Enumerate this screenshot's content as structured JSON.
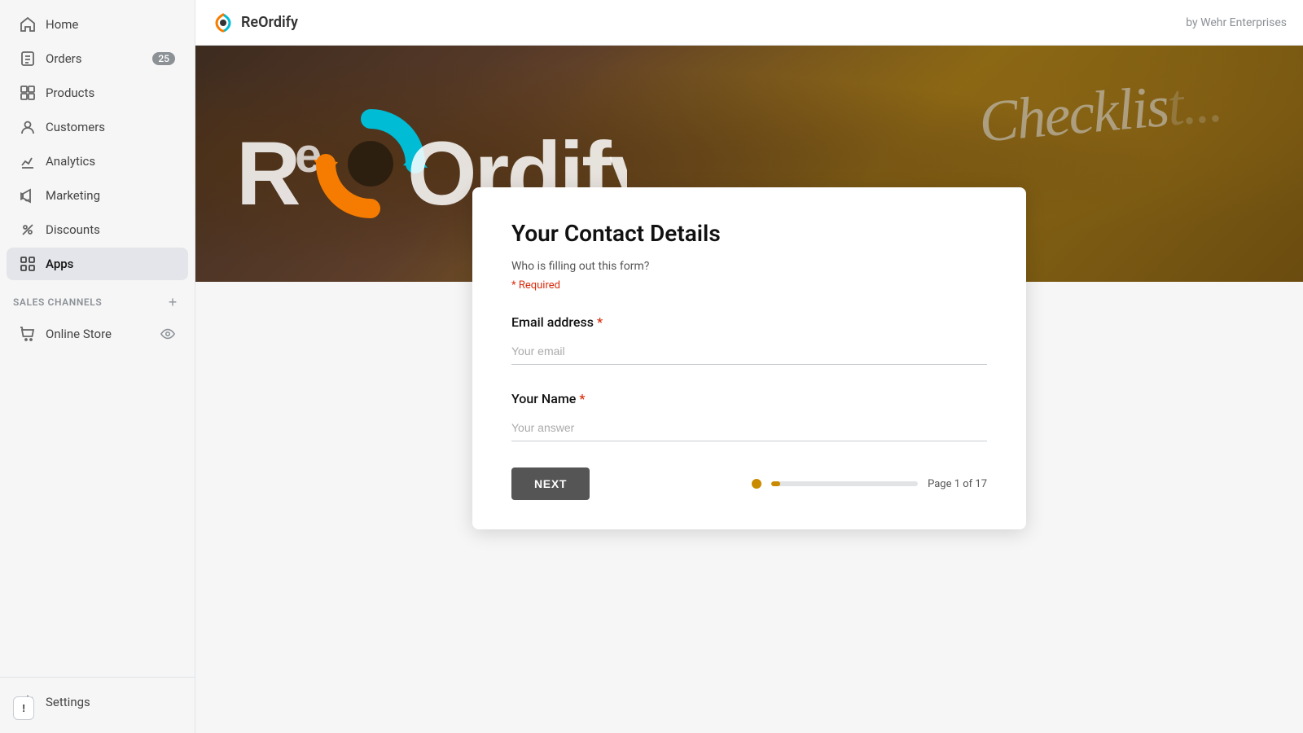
{
  "sidebar": {
    "items": [
      {
        "id": "home",
        "label": "Home",
        "icon": "home-icon",
        "badge": null,
        "active": false
      },
      {
        "id": "orders",
        "label": "Orders",
        "icon": "orders-icon",
        "badge": "25",
        "active": false
      },
      {
        "id": "products",
        "label": "Products",
        "icon": "products-icon",
        "badge": null,
        "active": false
      },
      {
        "id": "customers",
        "label": "Customers",
        "icon": "customers-icon",
        "badge": null,
        "active": false
      },
      {
        "id": "analytics",
        "label": "Analytics",
        "icon": "analytics-icon",
        "badge": null,
        "active": false
      },
      {
        "id": "marketing",
        "label": "Marketing",
        "icon": "marketing-icon",
        "badge": null,
        "active": false
      },
      {
        "id": "discounts",
        "label": "Discounts",
        "icon": "discounts-icon",
        "badge": null,
        "active": false
      },
      {
        "id": "apps",
        "label": "Apps",
        "icon": "apps-icon",
        "badge": null,
        "active": true
      }
    ],
    "sales_channels_label": "SALES CHANNELS",
    "sales_channels": [
      {
        "id": "online-store",
        "label": "Online Store"
      }
    ],
    "settings_label": "Settings"
  },
  "topbar": {
    "logo_text": "ReOrdify",
    "brand_text": "by Wehr Enterprises"
  },
  "form": {
    "title": "Your Contact Details",
    "subtitle": "Who is filling out this form?",
    "required_note": "* Required",
    "email_label": "Email address",
    "email_placeholder": "Your email",
    "name_label": "Your Name",
    "name_placeholder": "Your answer",
    "next_button": "NEXT",
    "page_indicator": "Page 1 of 17",
    "progress_percent": 5.88
  },
  "feedback": {
    "icon": "feedback-icon",
    "label": "!"
  },
  "colors": {
    "accent": "#c98a00",
    "required": "#d82c0d",
    "active_bg": "#e4e5ea"
  }
}
